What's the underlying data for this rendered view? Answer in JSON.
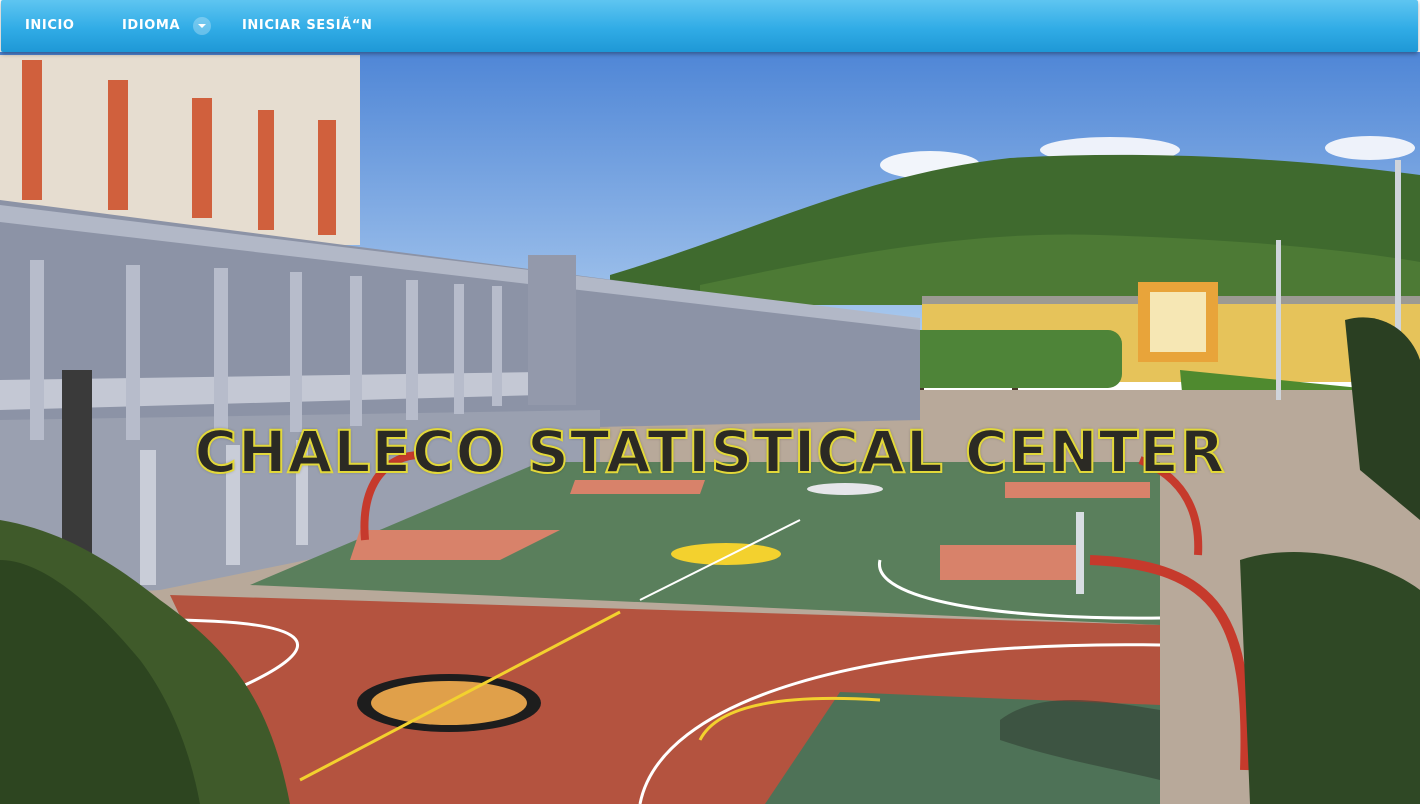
{
  "nav": {
    "home_label": "INICIO",
    "language_label": "IDIOMA",
    "login_label": "INICIAR SESIÃ“N"
  },
  "hero": {
    "title": "CHALECO STATISTICAL CENTER"
  },
  "colors": {
    "navbar": "#31ace6",
    "title_fill": "#2b2a24",
    "title_outline": "#e2d83a",
    "court_red": "#b5523e",
    "court_green": "#567a5b"
  }
}
